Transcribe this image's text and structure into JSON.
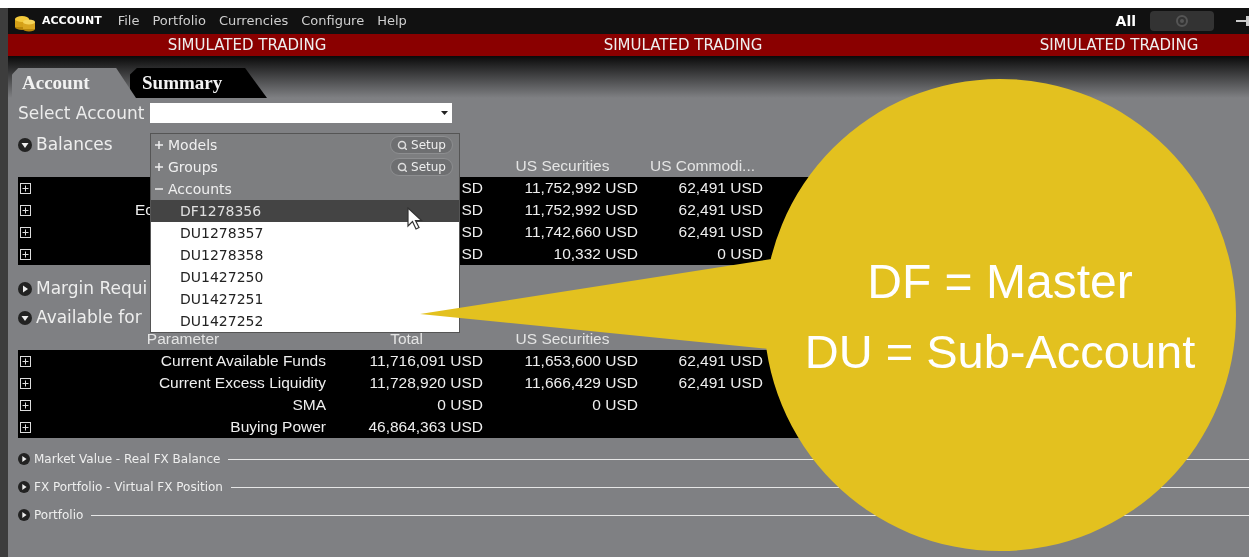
{
  "menu_bar": {
    "app_title": "ACCOUNT",
    "menus": [
      "File",
      "Portfolio",
      "Currencies",
      "Configure",
      "Help"
    ],
    "filter_label": "All"
  },
  "banner": [
    "SIMULATED TRADING",
    "SIMULATED TRADING",
    "SIMULATED TRADING"
  ],
  "tabs": [
    {
      "label": "Account",
      "selected": true
    },
    {
      "label": "Summary",
      "selected": false
    }
  ],
  "select_account": {
    "label": "Select Account"
  },
  "sections": [
    {
      "kind": "panel",
      "title": "Balances",
      "expanded": true,
      "table": {
        "header": {
          "us_securities": "US Securities",
          "column_4": "US Commodi..."
        },
        "rows": [
          {
            "total": "SD",
            "us_securities": "11,752,992 USD",
            "column_4": "62,491 USD"
          },
          {
            "parameter": "Ec",
            "total": "SD",
            "us_securities": "11,752,992 USD",
            "column_4": "62,491 USD"
          },
          {
            "total": "SD",
            "us_securities": "11,742,660 USD",
            "column_4": "62,491 USD"
          },
          {
            "total": "SD",
            "us_securities": "10,332 USD",
            "column_4": "0 USD"
          }
        ]
      }
    },
    {
      "kind": "panel",
      "title": "Margin Requi",
      "expanded": false
    },
    {
      "kind": "panel",
      "title": "Available for",
      "expanded": true,
      "table": {
        "header": {
          "parameter": "Parameter",
          "total": "Total",
          "us_securities": "US Securities"
        },
        "rows": [
          {
            "parameter": "Current Available Funds",
            "total": "11,716,091 USD",
            "us_securities": "11,653,600 USD",
            "column_4": "62,491 USD"
          },
          {
            "parameter": "Current Excess Liquidity",
            "total": "11,728,920 USD",
            "us_securities": "11,666,429 USD",
            "column_4": "62,491 USD"
          },
          {
            "parameter": "SMA",
            "total": "0 USD",
            "us_securities": "0 USD"
          },
          {
            "parameter": "Buying Power",
            "total": "46,864,363 USD"
          }
        ]
      }
    },
    {
      "kind": "divider",
      "title": "Market Value - Real FX Balance",
      "expanded": false
    },
    {
      "kind": "divider",
      "title": "FX Portfolio - Virtual FX Position",
      "expanded": false
    },
    {
      "kind": "divider",
      "title": "Portfolio",
      "expanded": false
    }
  ],
  "account_dropdown": {
    "groups": [
      {
        "label": "Models",
        "expanded": false,
        "button": "Setup"
      },
      {
        "label": "Groups",
        "expanded": false,
        "button": "Setup"
      },
      {
        "label": "Accounts",
        "expanded": true,
        "items": [
          {
            "label": "DF1278356",
            "selected": true
          },
          {
            "label": "DU1278357",
            "selected": false
          },
          {
            "label": "DU1278358",
            "selected": false
          },
          {
            "label": "DU1427250",
            "selected": false
          },
          {
            "label": "DU1427251",
            "selected": false
          },
          {
            "label": "DU1427252",
            "selected": false
          }
        ]
      }
    ]
  },
  "callout": {
    "lines": [
      "DF = Master",
      "DU = Sub-Account"
    ]
  }
}
